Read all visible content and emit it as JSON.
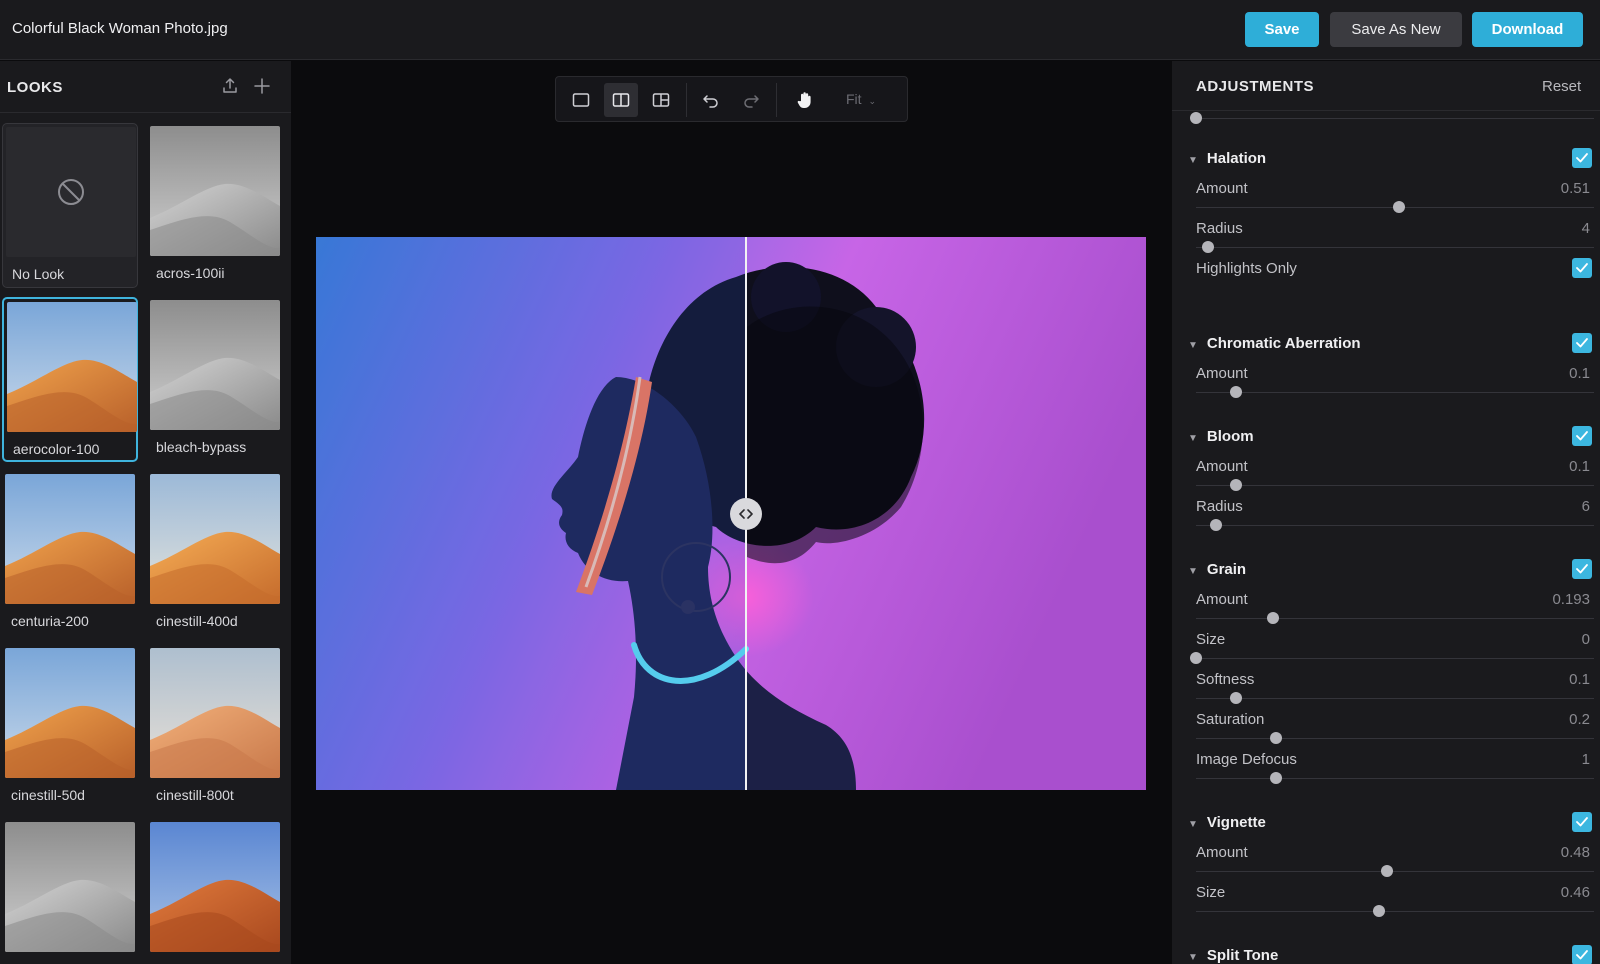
{
  "file": {
    "title": "Colorful Black Woman Photo.jpg"
  },
  "actions": {
    "save": "Save",
    "save_as_new": "Save As New",
    "download": "Download"
  },
  "looks": {
    "title": "LOOKS",
    "items": [
      {
        "label": "No Look",
        "style": "none"
      },
      {
        "label": "acros-100ii",
        "style": "mono"
      },
      {
        "label": "aerocolor-100",
        "style": "color",
        "selected": true
      },
      {
        "label": "bleach-bypass",
        "style": "mono"
      },
      {
        "label": "centuria-200",
        "style": "color"
      },
      {
        "label": "cinestill-400d",
        "style": "warm"
      },
      {
        "label": "cinestill-50d",
        "style": "color"
      },
      {
        "label": "cinestill-800t",
        "style": "faded"
      },
      {
        "label": "",
        "style": "mono"
      },
      {
        "label": "",
        "style": "deep"
      }
    ]
  },
  "toolbar": {
    "zoom": "Fit"
  },
  "adjustments": {
    "title": "ADJUSTMENTS",
    "reset": "Reset",
    "top_slider_fraction": 0.0,
    "sections": [
      {
        "name": "Halation",
        "enabled": true,
        "rows": [
          {
            "label": "Amount",
            "value": "0.51",
            "fraction": 0.51
          },
          {
            "label": "Radius",
            "value": "4",
            "fraction": 0.03
          },
          {
            "label": "Highlights Only",
            "toggle": true
          }
        ]
      },
      {
        "name": "Chromatic Aberration",
        "enabled": true,
        "rows": [
          {
            "label": "Amount",
            "value": "0.1",
            "fraction": 0.1
          }
        ]
      },
      {
        "name": "Bloom",
        "enabled": true,
        "rows": [
          {
            "label": "Amount",
            "value": "0.1",
            "fraction": 0.1
          },
          {
            "label": "Radius",
            "value": "6",
            "fraction": 0.05
          }
        ]
      },
      {
        "name": "Grain",
        "enabled": true,
        "rows": [
          {
            "label": "Amount",
            "value": "0.193",
            "fraction": 0.193
          },
          {
            "label": "Size",
            "value": "0",
            "fraction": 0.0
          },
          {
            "label": "Softness",
            "value": "0.1",
            "fraction": 0.1
          },
          {
            "label": "Saturation",
            "value": "0.2",
            "fraction": 0.2
          },
          {
            "label": "Image Defocus",
            "value": "1",
            "fraction": 0.2
          }
        ]
      },
      {
        "name": "Vignette",
        "enabled": true,
        "rows": [
          {
            "label": "Amount",
            "value": "0.48",
            "fraction": 0.48
          },
          {
            "label": "Size",
            "value": "0.46",
            "fraction": 0.46
          }
        ]
      },
      {
        "name": "Split Tone",
        "enabled": true,
        "rows": []
      }
    ]
  },
  "colors": {
    "accent": "#2eaed8",
    "panel": "#1a1a1d",
    "canvas": "#0b0b0d"
  }
}
